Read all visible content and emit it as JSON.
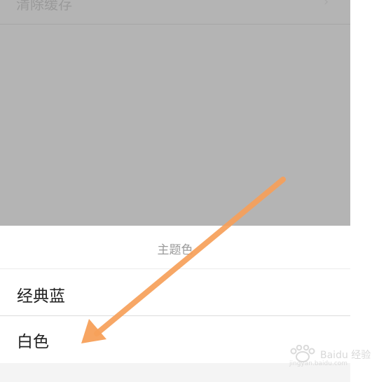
{
  "background_page": {
    "row_label": "清除缓存",
    "row_chevron_icon": "chevron-right-icon"
  },
  "sheet": {
    "title": "主题色",
    "options": [
      {
        "label": "经典蓝"
      },
      {
        "label": "白色"
      }
    ]
  },
  "annotation": {
    "icon": "arrow-annotation-icon",
    "color": "#f7a05a"
  },
  "watermark": {
    "text": "Baidu 经验",
    "url": "jingyan.baidu.com",
    "icon": "baidu-paw-logo"
  },
  "colors": {
    "overlay": "#b4b4b4",
    "sheet_background": "#ffffff",
    "text_primary": "#222222",
    "text_secondary": "#9b9b9b"
  }
}
